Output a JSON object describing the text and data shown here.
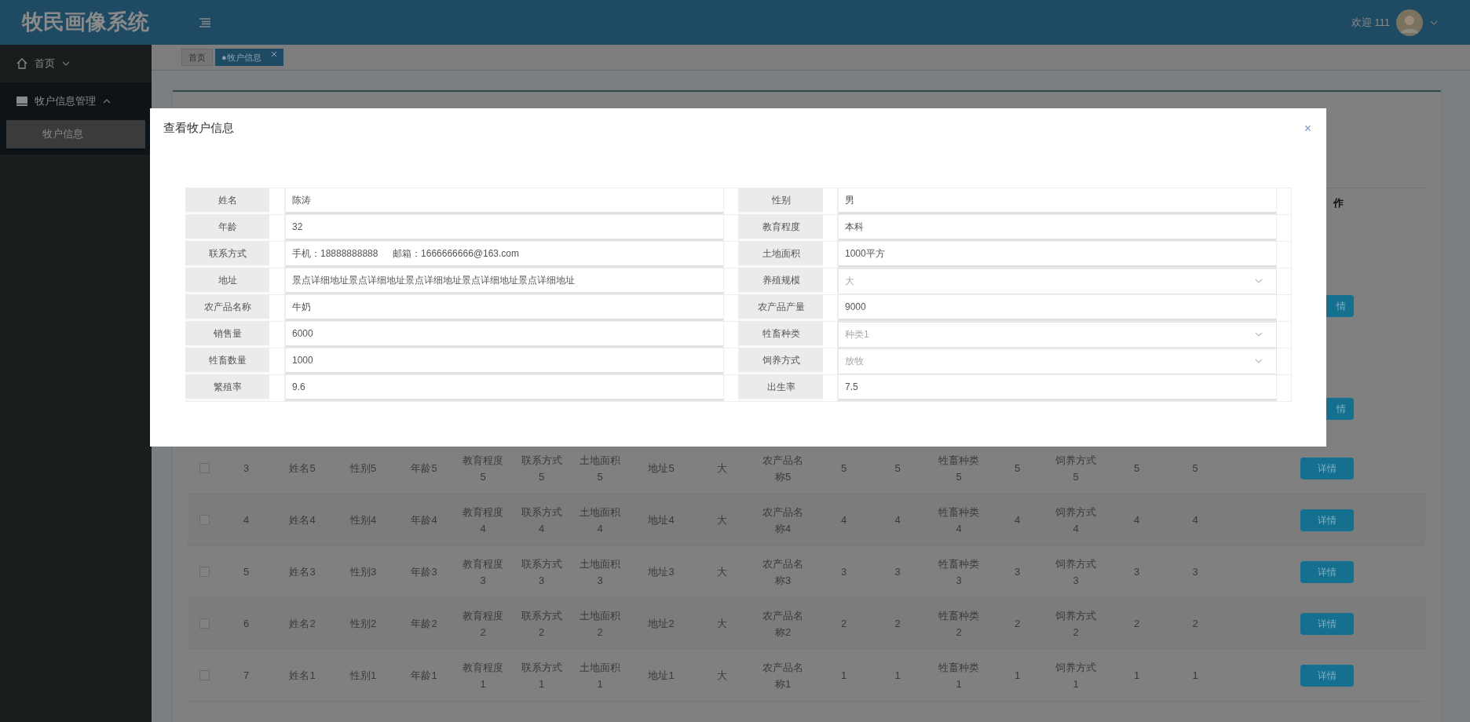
{
  "header": {
    "title": "牧民画像系统",
    "welcome": "欢迎 111"
  },
  "sidebar": {
    "items": [
      {
        "label": "首页",
        "expanded": false
      },
      {
        "label": "牧户信息管理",
        "expanded": true,
        "children": [
          {
            "label": "牧户信息",
            "selected": true
          }
        ]
      }
    ]
  },
  "tabs": [
    {
      "label": "首页",
      "selected": false,
      "closable": false
    },
    {
      "label": "●牧户信息",
      "selected": true,
      "closable": true
    }
  ],
  "table": {
    "action_header": "作",
    "covered_actions": [
      "情",
      "情"
    ],
    "rows": [
      {
        "checked": false,
        "cells": [
          "3",
          "姓名5",
          "性别5",
          "年龄5",
          "教育程度5",
          "联系方式5",
          "土地面积5",
          "地址5",
          "大",
          "农产品名称5",
          "5",
          "5",
          "牲畜种类5",
          "5",
          "饲养方式5",
          "5",
          "5"
        ],
        "action": "详情"
      },
      {
        "checked": false,
        "cells": [
          "4",
          "姓名4",
          "性别4",
          "年龄4",
          "教育程度4",
          "联系方式4",
          "土地面积4",
          "地址4",
          "大",
          "农产品名称4",
          "4",
          "4",
          "牲畜种类4",
          "4",
          "饲养方式4",
          "4",
          "4"
        ],
        "action": "详情"
      },
      {
        "checked": false,
        "cells": [
          "5",
          "姓名3",
          "性别3",
          "年龄3",
          "教育程度3",
          "联系方式3",
          "土地面积3",
          "地址3",
          "大",
          "农产品名称3",
          "3",
          "3",
          "牲畜种类3",
          "3",
          "饲养方式3",
          "3",
          "3"
        ],
        "action": "详情"
      },
      {
        "checked": false,
        "cells": [
          "6",
          "姓名2",
          "性别2",
          "年龄2",
          "教育程度2",
          "联系方式2",
          "土地面积2",
          "地址2",
          "大",
          "农产品名称2",
          "2",
          "2",
          "牲畜种类2",
          "2",
          "饲养方式2",
          "2",
          "2"
        ],
        "action": "详情"
      },
      {
        "checked": false,
        "cells": [
          "7",
          "姓名1",
          "性别1",
          "年龄1",
          "教育程度1",
          "联系方式1",
          "土地面积1",
          "地址1",
          "大",
          "农产品名称1",
          "1",
          "1",
          "牲畜种类1",
          "1",
          "饲养方式1",
          "1",
          "1"
        ],
        "action": "详情"
      }
    ]
  },
  "dialog": {
    "title": "查看牧户信息",
    "close": "×",
    "fields": [
      {
        "label": "姓名",
        "value": "陈涛",
        "kind": "text",
        "disabled": false
      },
      {
        "label": "性别",
        "value": "男",
        "kind": "text",
        "disabled": false
      },
      {
        "label": "年龄",
        "value": "32",
        "kind": "text",
        "disabled": false
      },
      {
        "label": "教育程度",
        "value": "本科",
        "kind": "text",
        "disabled": false
      },
      {
        "label": "联系方式",
        "value": "手机：18888888888 　 邮箱：1666666666@163.com",
        "kind": "text",
        "disabled": false
      },
      {
        "label": "土地面积",
        "value": "1000平方",
        "kind": "text",
        "disabled": false
      },
      {
        "label": "地址",
        "value": "景点详细地址景点详细地址景点详细地址景点详细地址景点详细地址",
        "kind": "text",
        "disabled": false
      },
      {
        "label": "养殖规模",
        "value": "大",
        "kind": "select",
        "disabled": true
      },
      {
        "label": "农产品名称",
        "value": "牛奶",
        "kind": "text",
        "disabled": false
      },
      {
        "label": "农产品产量",
        "value": "9000",
        "kind": "text",
        "disabled": false
      },
      {
        "label": "销售量",
        "value": "6000",
        "kind": "text",
        "disabled": false
      },
      {
        "label": "牲畜种类",
        "value": "种类1",
        "kind": "select",
        "disabled": true
      },
      {
        "label": "牲畜数量",
        "value": "1000",
        "kind": "text",
        "disabled": false
      },
      {
        "label": "饲养方式",
        "value": "放牧",
        "kind": "select",
        "disabled": true
      },
      {
        "label": "繁殖率",
        "value": "9.6",
        "kind": "text",
        "disabled": false
      },
      {
        "label": "出生率",
        "value": "7.5",
        "kind": "text",
        "disabled": false
      }
    ]
  }
}
